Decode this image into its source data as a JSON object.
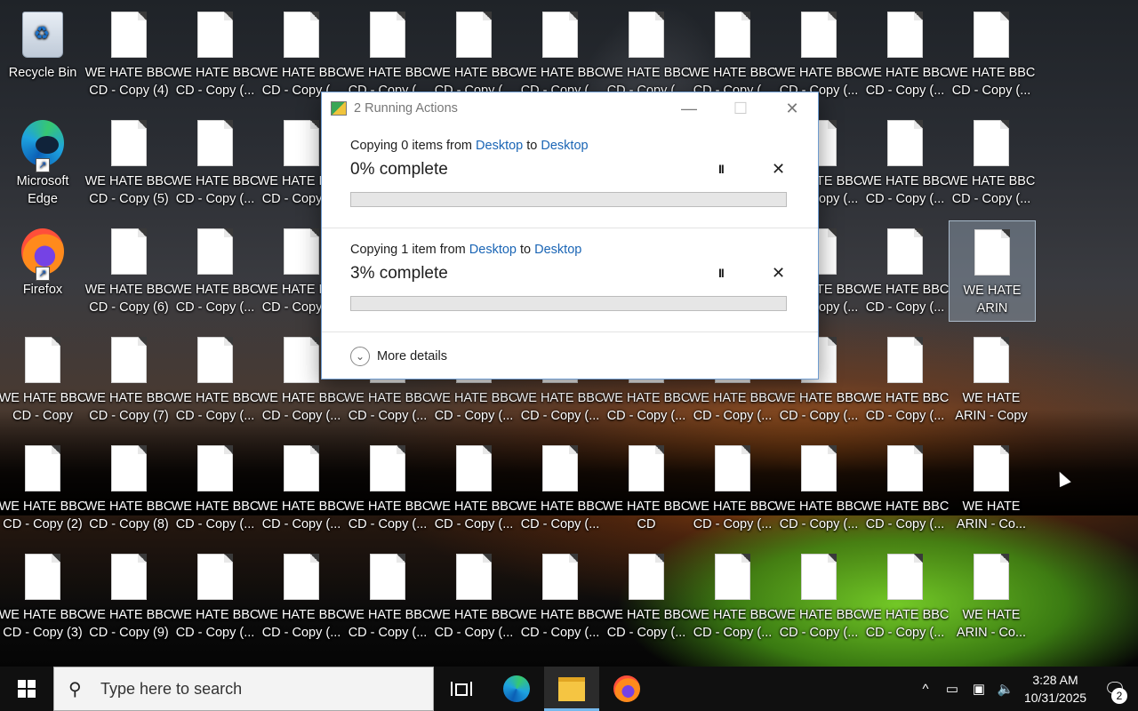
{
  "desktop": {
    "icons": [
      {
        "type": "recycle",
        "label": "Recycle Bin"
      },
      {
        "type": "doc",
        "label": "WE HATE BBC\nCD - Copy (4)"
      },
      {
        "type": "doc",
        "label": "WE HATE BBC\nCD - Copy (..."
      },
      {
        "type": "doc",
        "label": "WE HATE BBC\nCD - Copy (..."
      },
      {
        "type": "doc",
        "label": "WE HATE BBC\nCD - Copy (..."
      },
      {
        "type": "doc",
        "label": "WE HATE BBC\nCD - Copy (..."
      },
      {
        "type": "doc",
        "label": "WE HATE BBC\nCD - Copy (..."
      },
      {
        "type": "doc",
        "label": "WE HATE BBC\nCD - Copy (..."
      },
      {
        "type": "doc",
        "label": "WE HATE BBC\nCD - Copy (..."
      },
      {
        "type": "doc",
        "label": "WE HATE BBC\nCD - Copy (..."
      },
      {
        "type": "doc",
        "label": "WE HATE BBC\nCD - Copy (..."
      },
      {
        "type": "doc",
        "label": "WE HATE BBC\nCD - Copy (..."
      },
      {
        "type": "edge",
        "label": "Microsoft\nEdge"
      },
      {
        "type": "doc",
        "label": "WE HATE BBC\nCD - Copy (5)"
      },
      {
        "type": "doc",
        "label": "WE HATE BBC\nCD - Copy (..."
      },
      {
        "type": "doc",
        "label": "WE HATE BBC\nCD - Copy (..."
      },
      {
        "type": "doc",
        "label": ""
      },
      {
        "type": "doc",
        "label": ""
      },
      {
        "type": "doc",
        "label": ""
      },
      {
        "type": "doc",
        "label": ""
      },
      {
        "type": "doc",
        "label": ""
      },
      {
        "type": "doc",
        "label": "WE HATE BBC\nCD - Copy (..."
      },
      {
        "type": "doc",
        "label": "WE HATE BBC\nCD - Copy (..."
      },
      {
        "type": "doc",
        "label": "WE HATE BBC\nCD - Copy (..."
      },
      {
        "type": "firefox",
        "label": "Firefox"
      },
      {
        "type": "doc",
        "label": "WE HATE BBC\nCD - Copy (6)"
      },
      {
        "type": "doc",
        "label": "WE HATE BBC\nCD - Copy (..."
      },
      {
        "type": "doc",
        "label": "WE HATE BBC\nCD - Copy (..."
      },
      {
        "type": "doc",
        "label": ""
      },
      {
        "type": "doc",
        "label": ""
      },
      {
        "type": "doc",
        "label": ""
      },
      {
        "type": "doc",
        "label": ""
      },
      {
        "type": "doc",
        "label": ""
      },
      {
        "type": "doc",
        "label": "WE HATE BBC\nCD - Copy (..."
      },
      {
        "type": "doc",
        "label": "WE HATE BBC\nCD - Copy (..."
      },
      {
        "type": "doc",
        "label": "WE HATE\nARIN",
        "selected": true
      },
      {
        "type": "doc",
        "label": "WE HATE BBC\nCD - Copy"
      },
      {
        "type": "doc",
        "label": "WE HATE BBC\nCD - Copy (7)"
      },
      {
        "type": "doc",
        "label": "WE HATE BBC\nCD - Copy (..."
      },
      {
        "type": "doc",
        "label": "WE HATE BBC\nCD - Copy (..."
      },
      {
        "type": "doc",
        "label": "WE HATE BBC\nCD - Copy (..."
      },
      {
        "type": "doc",
        "label": "WE HATE BBC\nCD - Copy (..."
      },
      {
        "type": "doc",
        "label": "WE HATE BBC\nCD - Copy (..."
      },
      {
        "type": "doc",
        "label": "WE HATE BBC\nCD - Copy (..."
      },
      {
        "type": "doc",
        "label": "WE HATE BBC\nCD - Copy (..."
      },
      {
        "type": "doc",
        "label": "WE HATE BBC\nCD - Copy (..."
      },
      {
        "type": "doc",
        "label": "WE HATE BBC\nCD - Copy (..."
      },
      {
        "type": "doc",
        "label": "WE HATE\nARIN - Copy"
      },
      {
        "type": "doc",
        "label": "WE HATE BBC\nCD - Copy (2)"
      },
      {
        "type": "doc",
        "label": "WE HATE BBC\nCD - Copy (8)"
      },
      {
        "type": "doc",
        "label": "WE HATE BBC\nCD - Copy (..."
      },
      {
        "type": "doc",
        "label": "WE HATE BBC\nCD - Copy (..."
      },
      {
        "type": "doc",
        "label": "WE HATE BBC\nCD - Copy (..."
      },
      {
        "type": "doc",
        "label": "WE HATE BBC\nCD - Copy (..."
      },
      {
        "type": "doc",
        "label": "WE HATE BBC\nCD - Copy (..."
      },
      {
        "type": "doc",
        "label": "WE HATE BBC\nCD"
      },
      {
        "type": "doc",
        "label": "WE HATE BBC\nCD - Copy (..."
      },
      {
        "type": "doc",
        "label": "WE HATE BBC\nCD - Copy (..."
      },
      {
        "type": "doc",
        "label": "WE HATE BBC\nCD - Copy (..."
      },
      {
        "type": "doc",
        "label": "WE HATE\nARIN - Co..."
      },
      {
        "type": "doc",
        "label": "WE HATE BBC\nCD - Copy (3)"
      },
      {
        "type": "doc",
        "label": "WE HATE BBC\nCD - Copy (9)"
      },
      {
        "type": "doc",
        "label": "WE HATE BBC\nCD - Copy (..."
      },
      {
        "type": "doc",
        "label": "WE HATE BBC\nCD - Copy (..."
      },
      {
        "type": "doc",
        "label": "WE HATE BBC\nCD - Copy (..."
      },
      {
        "type": "doc",
        "label": "WE HATE BBC\nCD - Copy (..."
      },
      {
        "type": "doc",
        "label": "WE HATE BBC\nCD - Copy (..."
      },
      {
        "type": "doc",
        "label": "WE HATE BBC\nCD - Copy (..."
      },
      {
        "type": "doc",
        "label": "WE HATE BBC\nCD - Copy (..."
      },
      {
        "type": "doc",
        "label": "WE HATE BBC\nCD - Copy (..."
      },
      {
        "type": "doc",
        "label": "WE HATE BBC\nCD - Copy (..."
      },
      {
        "type": "doc",
        "label": "WE HATE\nARIN - Co..."
      }
    ]
  },
  "dialog": {
    "title": "2 Running Actions",
    "minimize_glyph": "—",
    "maximize_glyph": "☐",
    "close_glyph": "✕",
    "tasks": [
      {
        "prefix": "Copying 0 items from ",
        "source": "Desktop",
        "mid": " to ",
        "dest": "Desktop",
        "percent_text": "0% complete",
        "progress": 0.0
      },
      {
        "prefix": "Copying 1 item from ",
        "source": "Desktop",
        "mid": " to ",
        "dest": "Desktop",
        "percent_text": "3% complete",
        "progress": 0.0
      }
    ],
    "pause_glyph": "II",
    "cancel_glyph": "✕",
    "more_details": "More details",
    "more_glyph": "⌄",
    "link_color": "#1a65b5"
  },
  "taskbar": {
    "search_placeholder": "Type here to search",
    "search_glyph": "⚲",
    "tray": {
      "chevron": "^",
      "icons": [
        "▭",
        "▣",
        "🔈"
      ],
      "time": "3:28 AM",
      "date": "10/31/2025",
      "notif_glyph": "🗨",
      "notif_count": "2"
    }
  }
}
